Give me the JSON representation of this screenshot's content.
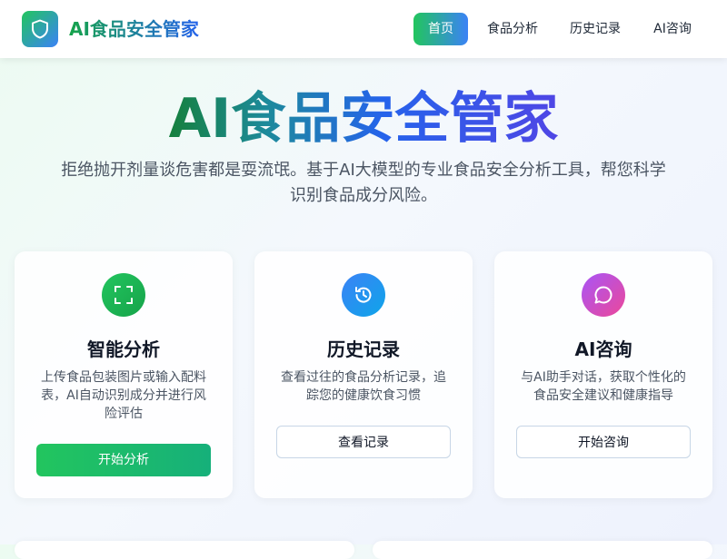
{
  "header": {
    "brand": "AI食品安全管家",
    "nav": [
      {
        "label": "首页",
        "active": true
      },
      {
        "label": "食品分析",
        "active": false
      },
      {
        "label": "历史记录",
        "active": false
      },
      {
        "label": "AI咨询",
        "active": false
      }
    ]
  },
  "hero": {
    "title": "AI食品安全管家",
    "subtitle": "拒绝抛开剂量谈危害都是耍流氓。基于AI大模型的专业食品安全分析工具，帮您科学识别食品成分风险。"
  },
  "cards": [
    {
      "icon": "scan-icon",
      "title": "智能分析",
      "desc": "上传食品包装图片或输入配料表，AI自动识别成分并进行风险评估",
      "button": "开始分析"
    },
    {
      "icon": "history-icon",
      "title": "历史记录",
      "desc": "查看过往的食品分析记录，追踪您的健康饮食习惯",
      "button": "查看记录"
    },
    {
      "icon": "chat-icon",
      "title": "AI咨询",
      "desc": "与AI助手对话，获取个性化的食品安全建议和健康指导",
      "button": "开始咨询"
    }
  ],
  "colors": {
    "brand_green": "#22c55e",
    "brand_blue": "#3b82f6",
    "brand_purple": "#a855f7"
  }
}
